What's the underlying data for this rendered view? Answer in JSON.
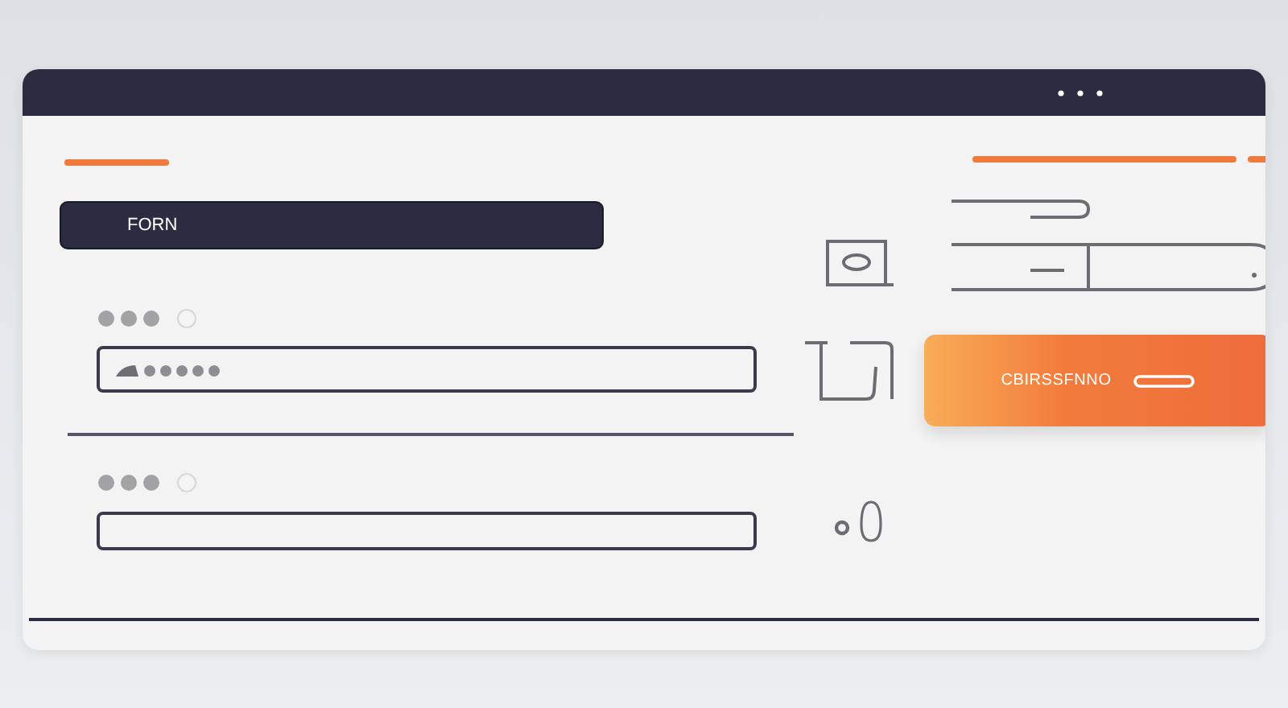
{
  "form": {
    "title": "FORN"
  },
  "fields": [
    {
      "masked": true
    },
    {
      "masked": false
    }
  ],
  "submit_button": {
    "label": "CBIRSSFNNO"
  }
}
